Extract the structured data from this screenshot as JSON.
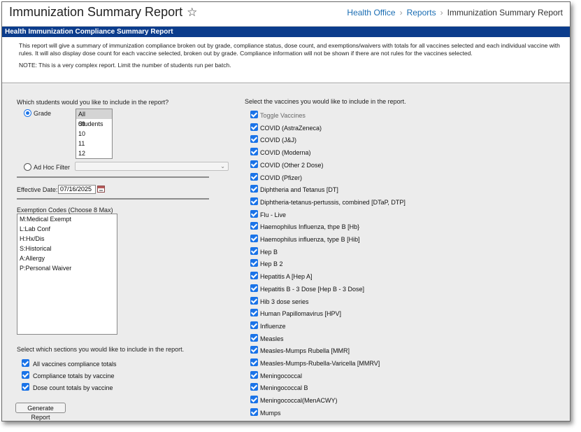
{
  "header": {
    "title": "Immunization Summary Report",
    "breadcrumb": [
      "Health Office",
      "Reports",
      "Immunization Summary Report"
    ]
  },
  "banner": "Health Immunization Compliance Summary Report",
  "description": {
    "text": "This report will give a summary of immunization compliance broken out by grade, compliance status, dose count, and exemptions/waivers with totals for all vaccines selected and each individual vaccine with rules. It will also display dose count for each vaccine selected, broken out by grade. Compliance information will not be shown if there are not rules for the vaccines selected.",
    "note": "NOTE: This is a very complex report. Limit the number of students run per batch."
  },
  "students": {
    "question": "Which students would you like to include in the report?",
    "grade_label": "Grade",
    "grade_options": [
      "All Students",
      "09",
      "10",
      "11",
      "12"
    ],
    "adhoc_label": "Ad Hoc Filter",
    "adhoc_value": ""
  },
  "effective_date": {
    "label": "Effective Date:",
    "value": "07/16/2025"
  },
  "exemptions": {
    "label": "Exemption Codes (Choose 8 Max)",
    "options": [
      "M:Medical Exempt",
      "L:Lab Conf",
      "H:Hx/Dis",
      "S:Historical",
      "A:Allergy",
      "P:Personal Waiver"
    ]
  },
  "sections": {
    "question": "Select which sections you would like to include in the report.",
    "options": [
      "All vaccines compliance totals",
      "Compliance totals by vaccine",
      "Dose count totals by vaccine"
    ]
  },
  "generate_button": "Generate Report",
  "vaccines": {
    "question": "Select the vaccines you would like to include in the report.",
    "toggle_label": "Toggle Vaccines",
    "items": [
      "COVID (AstraZeneca)",
      "COVID (J&J)",
      "COVID (Moderna)",
      "COVID (Other 2 Dose)",
      "COVID (Pfizer)",
      "Diphtheria and Tetanus [DT]",
      "Diphtheria-tetanus-pertussis, combined [DTaP, DTP]",
      "Flu - Live",
      "Haemophilus Influenza, thpe B [Hb}",
      "Haemophilus influenza, type B [Hib]",
      "Hep B",
      "Hep B 2",
      "Hepatitis A [Hep A]",
      "Hepatitis B - 3 Dose [Hep B - 3 Dose]",
      "Hib 3 dose series",
      "Human Papillomavirus [HPV]",
      "Influenze",
      "Measles",
      "Measles-Mumps Rubella [MMR]",
      "Measles-Mumps-Rubella-Varicella [MMRV]",
      "Meningococcal",
      "Meningococcal B",
      "Meningococcal(MenACWY)",
      "Mumps"
    ]
  },
  "colors": {
    "banner": "#0b3c8c",
    "checkbox": "#1a73e8",
    "link": "#1a6db3",
    "form_bg": "#ececec"
  },
  "icons": {
    "favorite": "star-icon",
    "breadcrumb_separator": "chevron-right-icon",
    "calendar": "calendar-icon",
    "dropdown": "chevron-down-icon"
  }
}
